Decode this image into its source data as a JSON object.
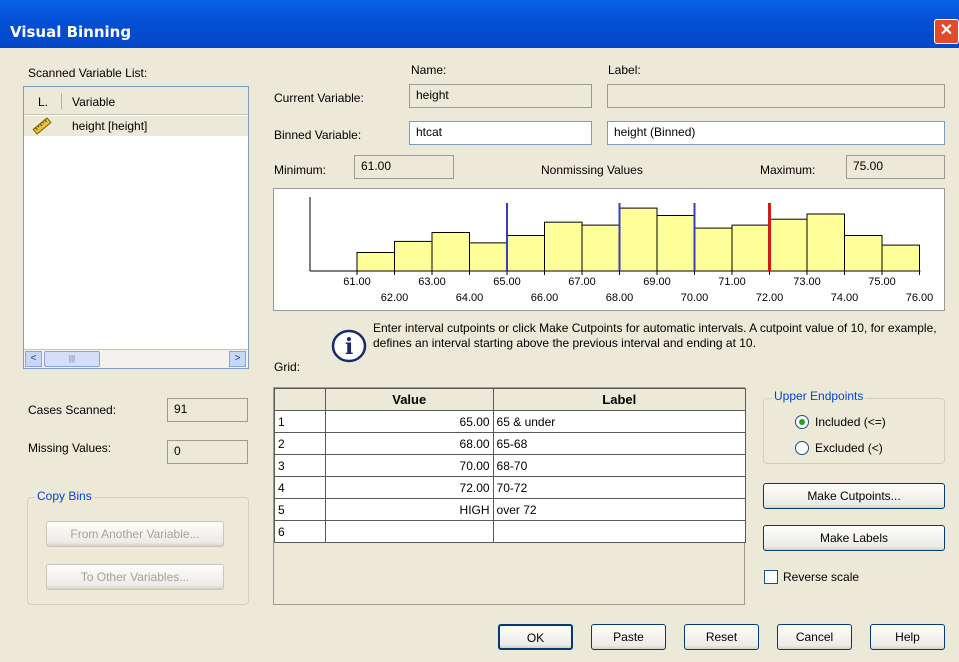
{
  "window": {
    "title": "Visual Binning",
    "close_glyph": "✕"
  },
  "scanned": {
    "label": "Scanned Variable List:",
    "col_l": "L.",
    "col_variable": "Variable",
    "items": [
      {
        "icon": "ruler-icon",
        "name": "height [height]"
      }
    ],
    "scroll_left": "<",
    "scroll_right": ">",
    "scroll_thumb": "|||"
  },
  "header": {
    "name_label": "Name:",
    "label_label": "Label:"
  },
  "current": {
    "label": "Current Variable:",
    "name": "height",
    "var_label": ""
  },
  "binned": {
    "label": "Binned Variable:",
    "name": "htcat",
    "var_label": "height (Binned)"
  },
  "stats": {
    "minimum_label": "Minimum:",
    "minimum": "61.00",
    "nonmissing_label": "Nonmissing Values",
    "maximum_label": "Maximum:",
    "maximum": "75.00"
  },
  "chart_data": {
    "type": "bar",
    "title": "Nonmissing Values",
    "xlim": [
      60,
      76
    ],
    "bins": [
      {
        "x0": 61,
        "x1": 62,
        "h": 0.25
      },
      {
        "x0": 62,
        "x1": 63,
        "h": 0.4
      },
      {
        "x0": 63,
        "x1": 64,
        "h": 0.52
      },
      {
        "x0": 64,
        "x1": 65,
        "h": 0.38
      },
      {
        "x0": 65,
        "x1": 66,
        "h": 0.48
      },
      {
        "x0": 66,
        "x1": 67,
        "h": 0.66
      },
      {
        "x0": 67,
        "x1": 68,
        "h": 0.62
      },
      {
        "x0": 68,
        "x1": 69,
        "h": 0.85
      },
      {
        "x0": 69,
        "x1": 70,
        "h": 0.75
      },
      {
        "x0": 70,
        "x1": 71,
        "h": 0.58
      },
      {
        "x0": 71,
        "x1": 72,
        "h": 0.62
      },
      {
        "x0": 72,
        "x1": 73,
        "h": 0.7
      },
      {
        "x0": 73,
        "x1": 74,
        "h": 0.77
      },
      {
        "x0": 74,
        "x1": 75,
        "h": 0.48
      },
      {
        "x0": 75,
        "x1": 76,
        "h": 0.35
      }
    ],
    "cutpoints": [
      {
        "x": 65,
        "color": "#3b3bbf"
      },
      {
        "x": 68,
        "color": "#3b3bbf"
      },
      {
        "x": 70,
        "color": "#3b3bbf"
      },
      {
        "x": 72,
        "color": "#d11a1a"
      }
    ],
    "ticks_top": [
      "61.00",
      "63.00",
      "65.00",
      "67.00",
      "69.00",
      "71.00",
      "73.00",
      "75.00"
    ],
    "ticks_bottom": [
      "62.00",
      "64.00",
      "66.00",
      "68.00",
      "70.00",
      "72.00",
      "74.00",
      "76.00"
    ],
    "bar_color": "#ffff99"
  },
  "info": {
    "grid_label": "Grid:",
    "icon": "info-icon",
    "text": "Enter interval cutpoints or click Make Cutpoints for automatic intervals.  A cutpoint value of 10, for example, defines an interval starting above the previous interval and ending at 10."
  },
  "grid": {
    "col_value": "Value",
    "col_label": "Label",
    "rows": [
      {
        "num": "1",
        "value": "65.00",
        "label": "65 & under"
      },
      {
        "num": "2",
        "value": "68.00",
        "label": "65-68"
      },
      {
        "num": "3",
        "value": "70.00",
        "label": "68-70"
      },
      {
        "num": "4",
        "value": "72.00",
        "label": "70-72"
      },
      {
        "num": "5",
        "value": "HIGH",
        "label": "over 72"
      },
      {
        "num": "6",
        "value": "",
        "label": ""
      }
    ]
  },
  "counts": {
    "cases_label": "Cases Scanned:",
    "cases": "91",
    "missing_label": "Missing Values:",
    "missing": "0"
  },
  "copy_bins": {
    "title": "Copy Bins",
    "from": "From Another Variable...",
    "to": "To Other Variables..."
  },
  "upper": {
    "title": "Upper Endpoints",
    "included": "Included (<=)",
    "excluded": "Excluded (<)",
    "selected": "included"
  },
  "actions": {
    "make_cutpoints": "Make Cutpoints...",
    "make_labels": "Make Labels",
    "reverse_scale": "Reverse scale",
    "reverse_checked": false
  },
  "footer": {
    "ok": "OK",
    "paste": "Paste",
    "reset": "Reset",
    "cancel": "Cancel",
    "help": "Help"
  }
}
